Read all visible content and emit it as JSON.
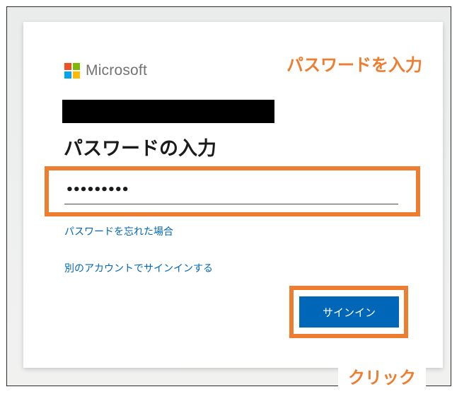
{
  "brand": {
    "name": "Microsoft",
    "logo_colors": [
      "#f25022",
      "#7fba00",
      "#00a4ef",
      "#ffb900"
    ]
  },
  "form": {
    "title": "パスワードの入力",
    "password_value": "•••••••••",
    "forgot_link": "パスワードを忘れた場合",
    "other_account_link": "別のアカウントでサインインする",
    "signin_button": "サインイン"
  },
  "annotations": {
    "password_label": "パスワードを入力",
    "click_label": "クリック",
    "highlight_color": "#ed7d31"
  },
  "colors": {
    "accent": "#0067b8",
    "button_text": "#ffffff"
  }
}
